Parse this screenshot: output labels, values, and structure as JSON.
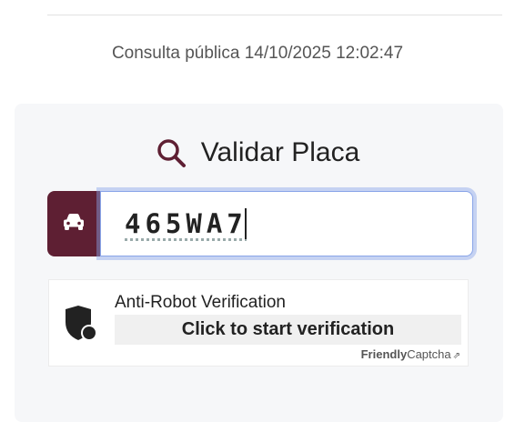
{
  "header": {
    "timestamp": "Consulta pública 14/10/2025 12:02:47"
  },
  "form": {
    "title": "Validar Placa",
    "plate_value": "465WA7"
  },
  "captcha": {
    "title": "Anti-Robot Verification",
    "button_label": "Click to start verification",
    "brand_bold": "Friendly",
    "brand_rest": "Captcha",
    "brand_link_glyph": "⇗"
  },
  "colors": {
    "accent": "#5e1f33",
    "focus_ring": "#89a4e8",
    "card_bg": "#f6f7f9"
  },
  "icons": {
    "title": "search-icon",
    "prefix": "car-icon",
    "captcha": "shield-icon"
  }
}
